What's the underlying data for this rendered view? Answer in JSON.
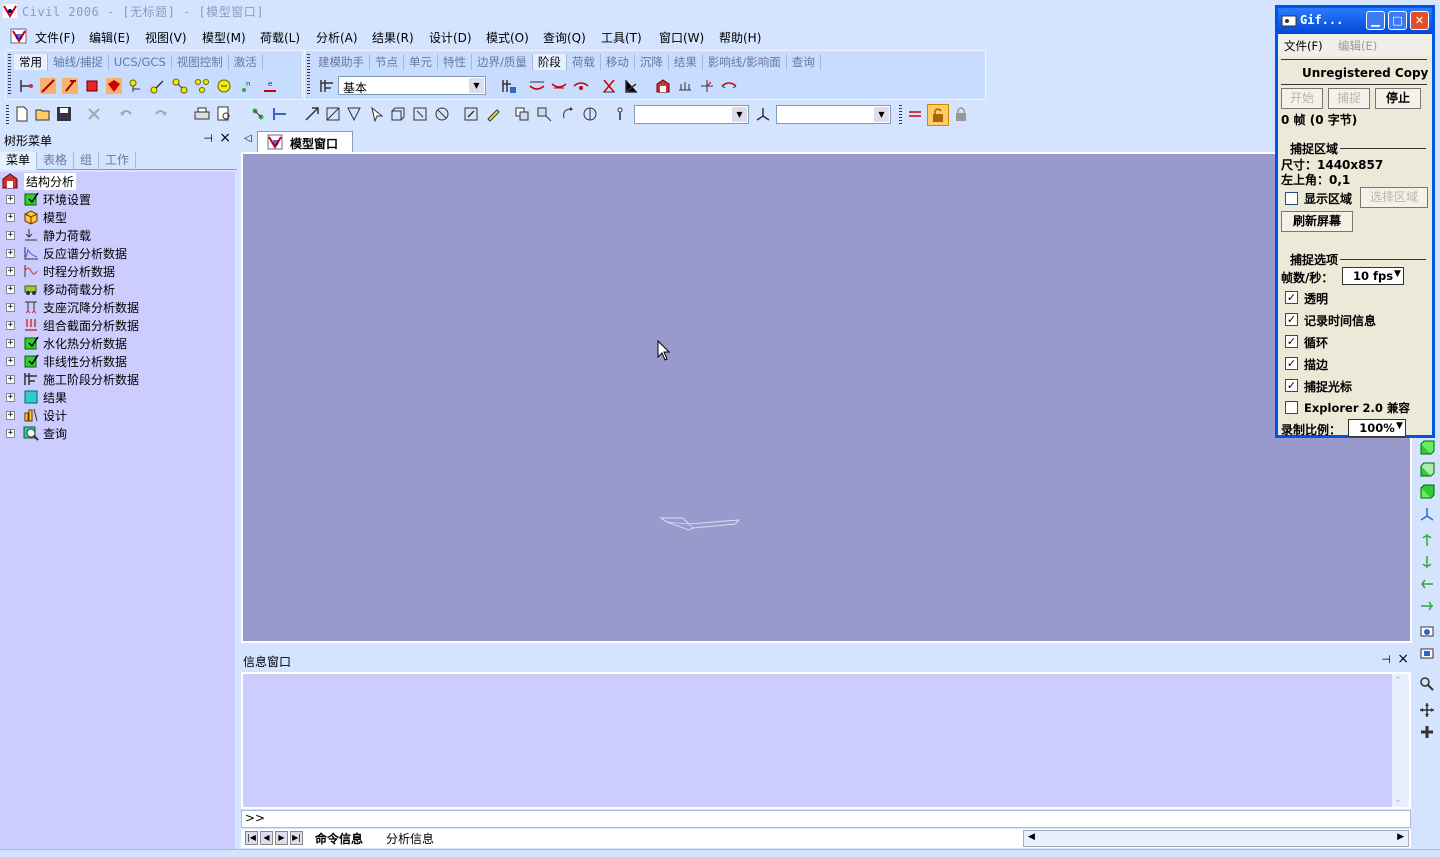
{
  "window": {
    "title": "Civil 2006 - [无标题] - [模型窗口]"
  },
  "menu": [
    "文件(F)",
    "编辑(E)",
    "视图(V)",
    "模型(M)",
    "荷载(L)",
    "分析(A)",
    "结果(R)",
    "设计(D)",
    "模式(O)",
    "查询(Q)",
    "工具(T)",
    "窗口(W)",
    "帮助(H)"
  ],
  "toolbar_left_tabs": [
    "常用",
    "轴线/捕捉",
    "UCS/GCS",
    "视图控制",
    "激活"
  ],
  "toolbar_right_tabs": [
    "建模助手",
    "节点",
    "单元",
    "特性",
    "边界/质量",
    "阶段",
    "荷载",
    "移动",
    "沉降",
    "结果",
    "影响线/影响面",
    "查询"
  ],
  "toolbar_right_active": "阶段",
  "stage_select": "基本",
  "tree_panel": {
    "title": "树形菜单",
    "tabs": [
      "菜单",
      "表格",
      "组",
      "工作"
    ],
    "root": "结构分析",
    "items": [
      "环境设置",
      "模型",
      "静力荷载",
      "反应谱分析数据",
      "时程分析数据",
      "移动荷载分析",
      "支座沉降分析数据",
      "组合截面分析数据",
      "水化热分析数据",
      "非线性分析数据",
      "施工阶段分析数据",
      "结果",
      "设计",
      "查询"
    ]
  },
  "doc_tab": "模型窗口",
  "info_panel": {
    "title": "信息窗口",
    "prompt": ">>",
    "tabs": [
      "命令信息",
      "分析信息"
    ]
  },
  "gif_window": {
    "title": "Gif...",
    "menu": [
      "文件(F)",
      "编辑(E)"
    ],
    "unregistered": "Unregistered Copy",
    "buttons": {
      "start": "开始",
      "capture": "捕捉",
      "stop": "停止"
    },
    "frames": "0 帧 (0 字节)",
    "capture_area": {
      "header": "捕捉区域",
      "size": "尺寸：1440x857",
      "top_left": "左上角：0,1",
      "show_area": "显示区域",
      "select_area": "选择区域",
      "refresh": "刷新屏幕"
    },
    "capture_options": {
      "header": "捕捉选项",
      "fps_label": "帧数/秒：",
      "fps_value": "10 fps",
      "checks": [
        {
          "label": "透明",
          "checked": true
        },
        {
          "label": "记录时间信息",
          "checked": true
        },
        {
          "label": "循环",
          "checked": true
        },
        {
          "label": "描边",
          "checked": true
        },
        {
          "label": "捕捉光标",
          "checked": true
        },
        {
          "label": "Explorer 2.0 兼容",
          "checked": false
        }
      ],
      "scale_label": "录制比例：",
      "scale_value": "100%"
    }
  }
}
